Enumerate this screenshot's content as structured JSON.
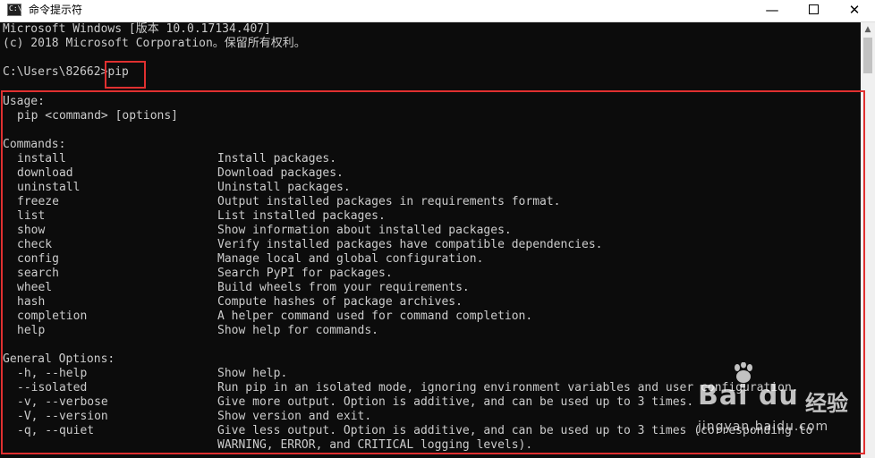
{
  "window": {
    "title": "命令提示符",
    "icon_label": "C:\\",
    "buttons": {
      "minimize": "—",
      "close": "✕"
    }
  },
  "console": {
    "header": [
      "Microsoft Windows [版本 10.0.17134.407]",
      "(c) 2018 Microsoft Corporation。保留所有权利。"
    ],
    "prompt": "C:\\Users\\82662>",
    "command": "pip",
    "usage_title": "Usage:",
    "usage_line": "pip <command> [options]",
    "commands_title": "Commands:",
    "commands": [
      {
        "name": "install",
        "desc": "Install packages."
      },
      {
        "name": "download",
        "desc": "Download packages."
      },
      {
        "name": "uninstall",
        "desc": "Uninstall packages."
      },
      {
        "name": "freeze",
        "desc": "Output installed packages in requirements format."
      },
      {
        "name": "list",
        "desc": "List installed packages."
      },
      {
        "name": "show",
        "desc": "Show information about installed packages."
      },
      {
        "name": "check",
        "desc": "Verify installed packages have compatible dependencies."
      },
      {
        "name": "config",
        "desc": "Manage local and global configuration."
      },
      {
        "name": "search",
        "desc": "Search PyPI for packages."
      },
      {
        "name": "wheel",
        "desc": "Build wheels from your requirements."
      },
      {
        "name": "hash",
        "desc": "Compute hashes of package archives."
      },
      {
        "name": "completion",
        "desc": "A helper command used for command completion."
      },
      {
        "name": "help",
        "desc": "Show help for commands."
      }
    ],
    "general_title": "General Options:",
    "options": [
      {
        "name": "-h, --help",
        "desc": "Show help."
      },
      {
        "name": "--isolated",
        "desc": "Run pip in an isolated mode, ignoring environment variables and user configuration."
      },
      {
        "name": "-v, --verbose",
        "desc": "Give more output. Option is additive, and can be used up to 3 times."
      },
      {
        "name": "-V, --version",
        "desc": "Show version and exit."
      },
      {
        "name": "-q, --quiet",
        "desc": "Give less output. Option is additive, and can be used up to 3 times (corresponding to"
      }
    ],
    "continuation": "WARNING, ERROR, and CRITICAL logging levels)."
  },
  "watermark": {
    "brand": "Bai du",
    "brand_cn": "经验",
    "url": "jingyan.baidu.com"
  },
  "colors": {
    "console_bg": "#0c0c0c",
    "console_text": "#cccccc",
    "annotation": "#e03030"
  },
  "icons": [
    "cmd-app-icon",
    "minimize-icon",
    "maximize-icon",
    "close-icon",
    "scroll-up-arrow-icon",
    "baidu-paw-icon"
  ]
}
